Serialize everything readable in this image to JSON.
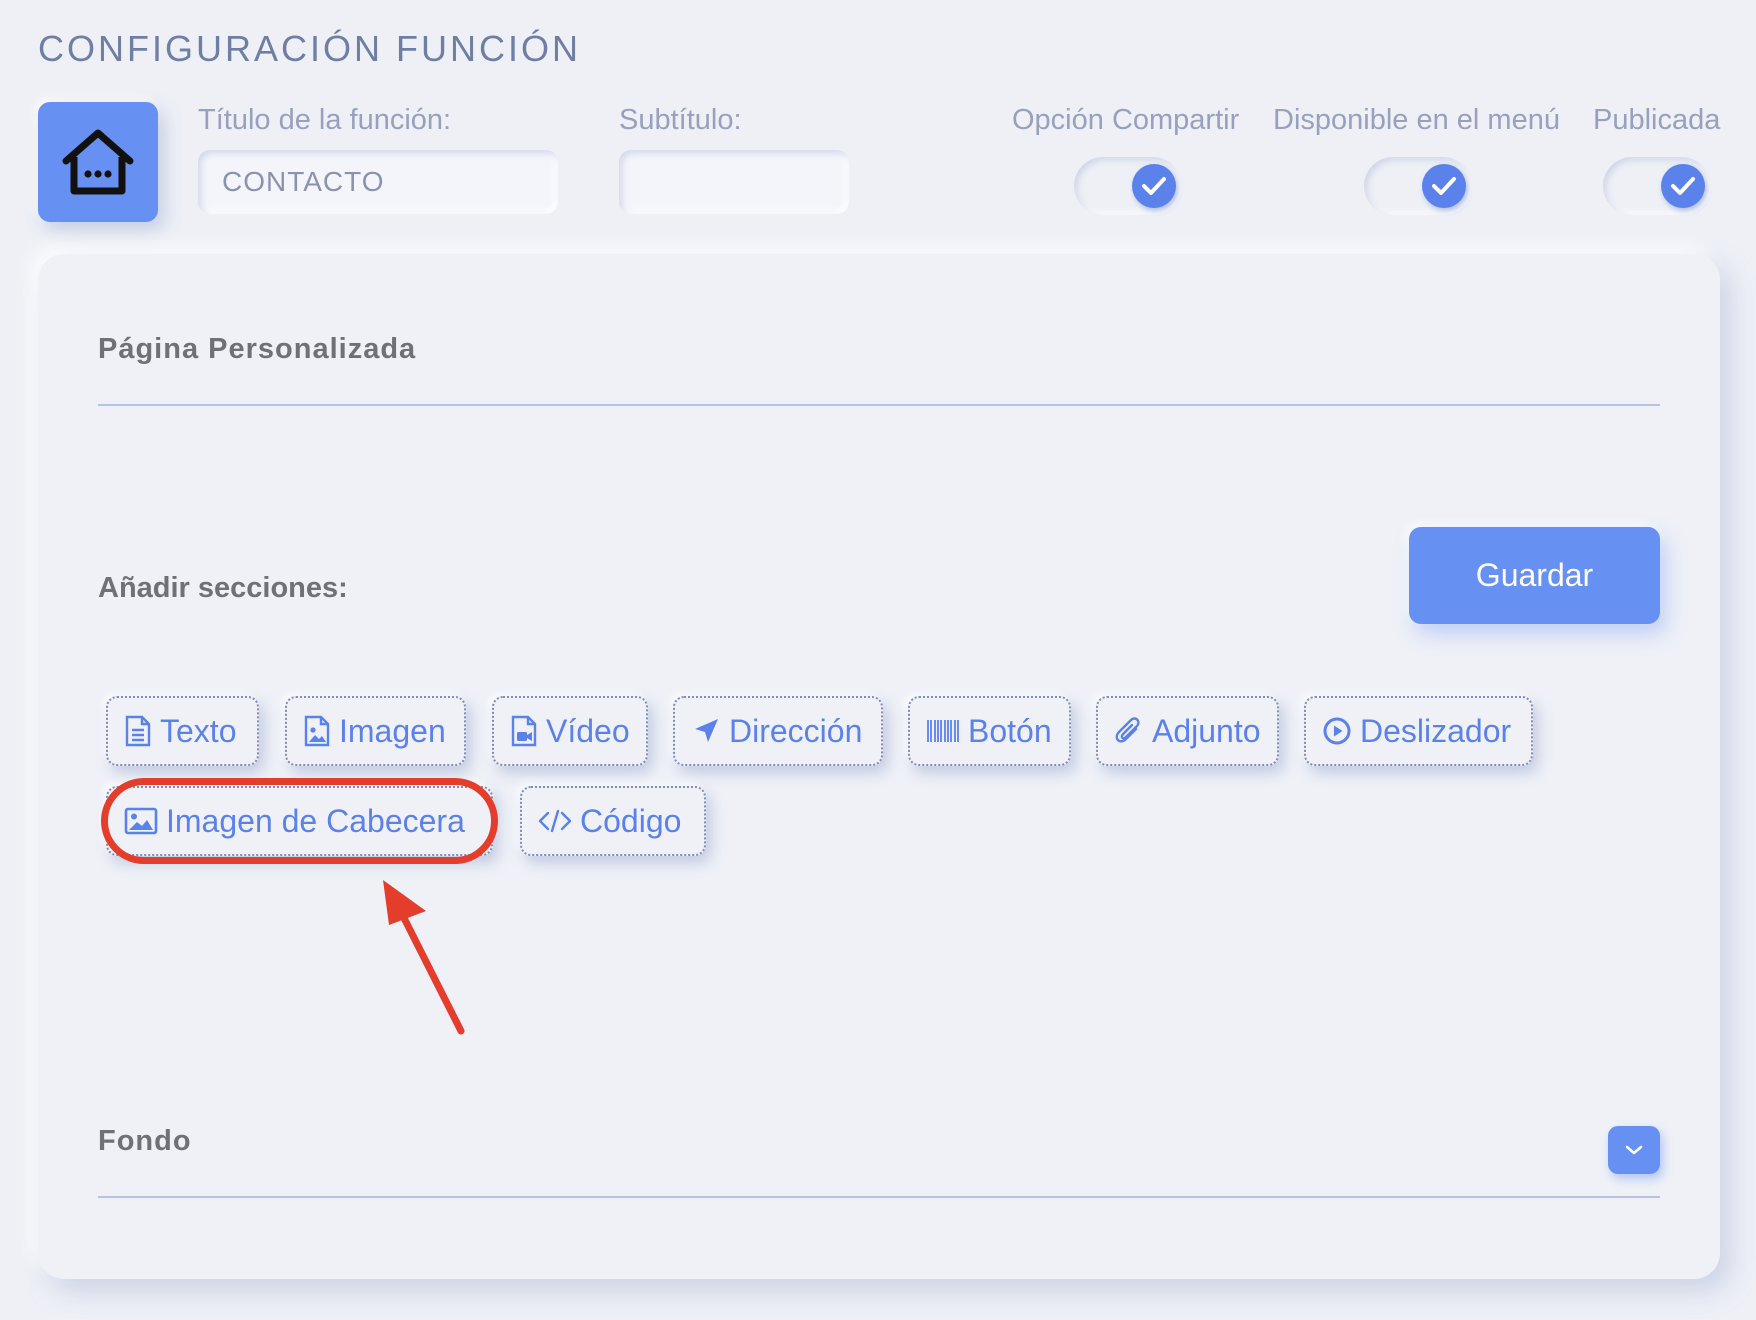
{
  "page": {
    "title": "CONFIGURACIÓN FUNCIÓN"
  },
  "function_form": {
    "title_label": "Título de la función:",
    "title_value": "CONTACTO",
    "subtitle_label": "Subtítulo:",
    "subtitle_value": ""
  },
  "toggles": [
    {
      "label": "Opción Compartir",
      "checked": true
    },
    {
      "label": "Disponible en el menú",
      "checked": true
    },
    {
      "label": "Publicada",
      "checked": true
    }
  ],
  "custom_page": {
    "heading": "Página Personalizada"
  },
  "sections": {
    "heading": "Añadir secciones:",
    "save_label": "Guardar",
    "items": [
      {
        "label": "Texto",
        "icon": "document-icon"
      },
      {
        "label": "Imagen",
        "icon": "image-file-icon"
      },
      {
        "label": "Vídeo",
        "icon": "video-file-icon"
      },
      {
        "label": "Dirección",
        "icon": "location-arrow-icon"
      },
      {
        "label": "Botón",
        "icon": "barcode-icon"
      },
      {
        "label": "Adjunto",
        "icon": "paperclip-icon"
      },
      {
        "label": "Deslizador",
        "icon": "play-circle-icon"
      },
      {
        "label": "Imagen de Cabecera",
        "icon": "picture-icon"
      },
      {
        "label": "Código",
        "icon": "code-icon"
      }
    ]
  },
  "background": {
    "heading": "Fondo"
  },
  "colors": {
    "accent": "#6690f2",
    "chip_text": "#5b82ea",
    "annotation": "#e43d2c",
    "page_bg": "#eef0f6"
  }
}
